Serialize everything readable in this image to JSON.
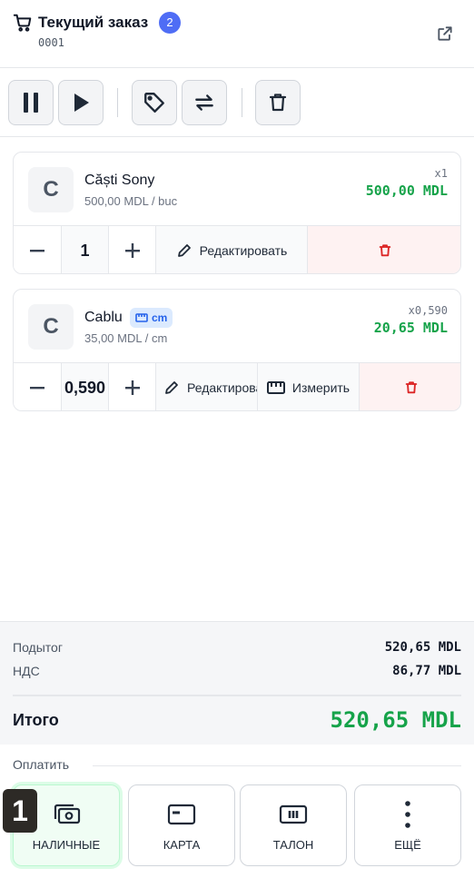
{
  "header": {
    "title": "Текущий заказ",
    "item_count": "2",
    "order_number": "0001",
    "icons": {
      "cart": "shopping-cart-icon",
      "open": "external-link-icon"
    }
  },
  "toolbar": {
    "buttons": [
      "pause-icon",
      "play-icon",
      "tag-icon",
      "swap-icon",
      "trash-icon"
    ]
  },
  "items": [
    {
      "avatar": "C",
      "name": "Căști Sony",
      "unit_price": "500,00 MDL / buc",
      "qty_label": "x1",
      "total": "500,00 MDL",
      "qty": "1",
      "edit_label": "Редактировать"
    },
    {
      "avatar": "C",
      "name": "Cablu",
      "unit_badge": "cm",
      "unit_price": "35,00 MDL / cm",
      "qty_label": "x0,590",
      "total": "20,65 MDL",
      "qty": "0,590",
      "edit_label": "Редактировать",
      "measure_label": "Измерить"
    }
  ],
  "summary": {
    "subtotal_label": "Подытог",
    "subtotal_value": "520,65 MDL",
    "vat_label": "НДС",
    "vat_value": "86,77 MDL",
    "total_label": "Итого",
    "total_value": "520,65 MDL"
  },
  "payment": {
    "section_label": "Оплатить",
    "hotkey": "1",
    "methods": [
      {
        "label": "НАЛИЧНЫЕ",
        "icon": "cash-icon",
        "active": true
      },
      {
        "label": "КАРТА",
        "icon": "card-icon",
        "active": false
      },
      {
        "label": "ТАЛОН",
        "icon": "voucher-icon",
        "active": false
      },
      {
        "label": "ЕЩЁ",
        "icon": "more-icon",
        "active": false
      }
    ]
  },
  "colors": {
    "accent_blue": "#4f6df5",
    "price_green": "#16a34a",
    "danger_red": "#dc2626"
  }
}
